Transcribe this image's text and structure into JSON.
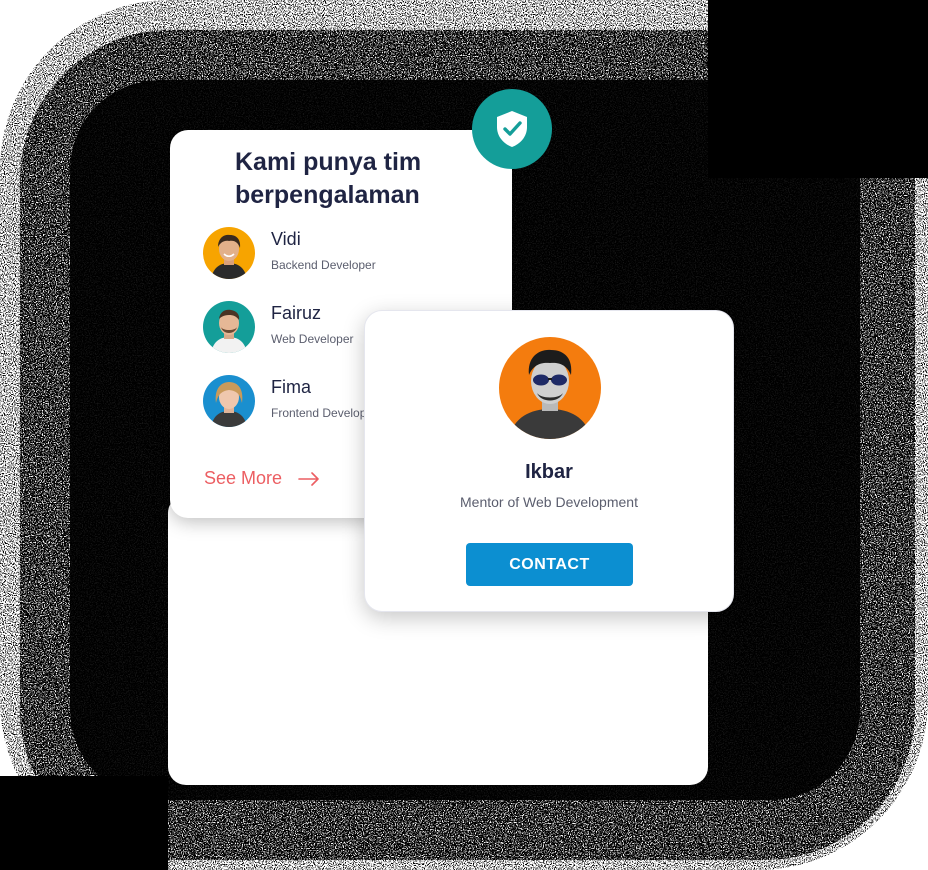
{
  "team_card": {
    "title": "Kami punya tim berpengalaman",
    "members": [
      {
        "name": "Vidi",
        "role": "Backend Developer",
        "avatar_bg": "#f7a400"
      },
      {
        "name": "Fairuz",
        "role": "Web Developer",
        "avatar_bg": "#149e99"
      },
      {
        "name": "Fima",
        "role": "Frontend Developer",
        "avatar_bg": "#1a8fcf"
      }
    ],
    "see_more_label": "See More",
    "see_more_icon": "arrow-right-icon"
  },
  "badge": {
    "icon": "shield-check-icon",
    "color": "#149e99"
  },
  "profile": {
    "name": "Ikbar",
    "role": "Mentor of Web Development",
    "contact_label": "CONTACT",
    "avatar_bg": "#f47c0e"
  },
  "colors": {
    "heading": "#1f2443",
    "accent_link": "#ec5e62",
    "button": "#0c8fd1",
    "badge": "#149e99"
  }
}
